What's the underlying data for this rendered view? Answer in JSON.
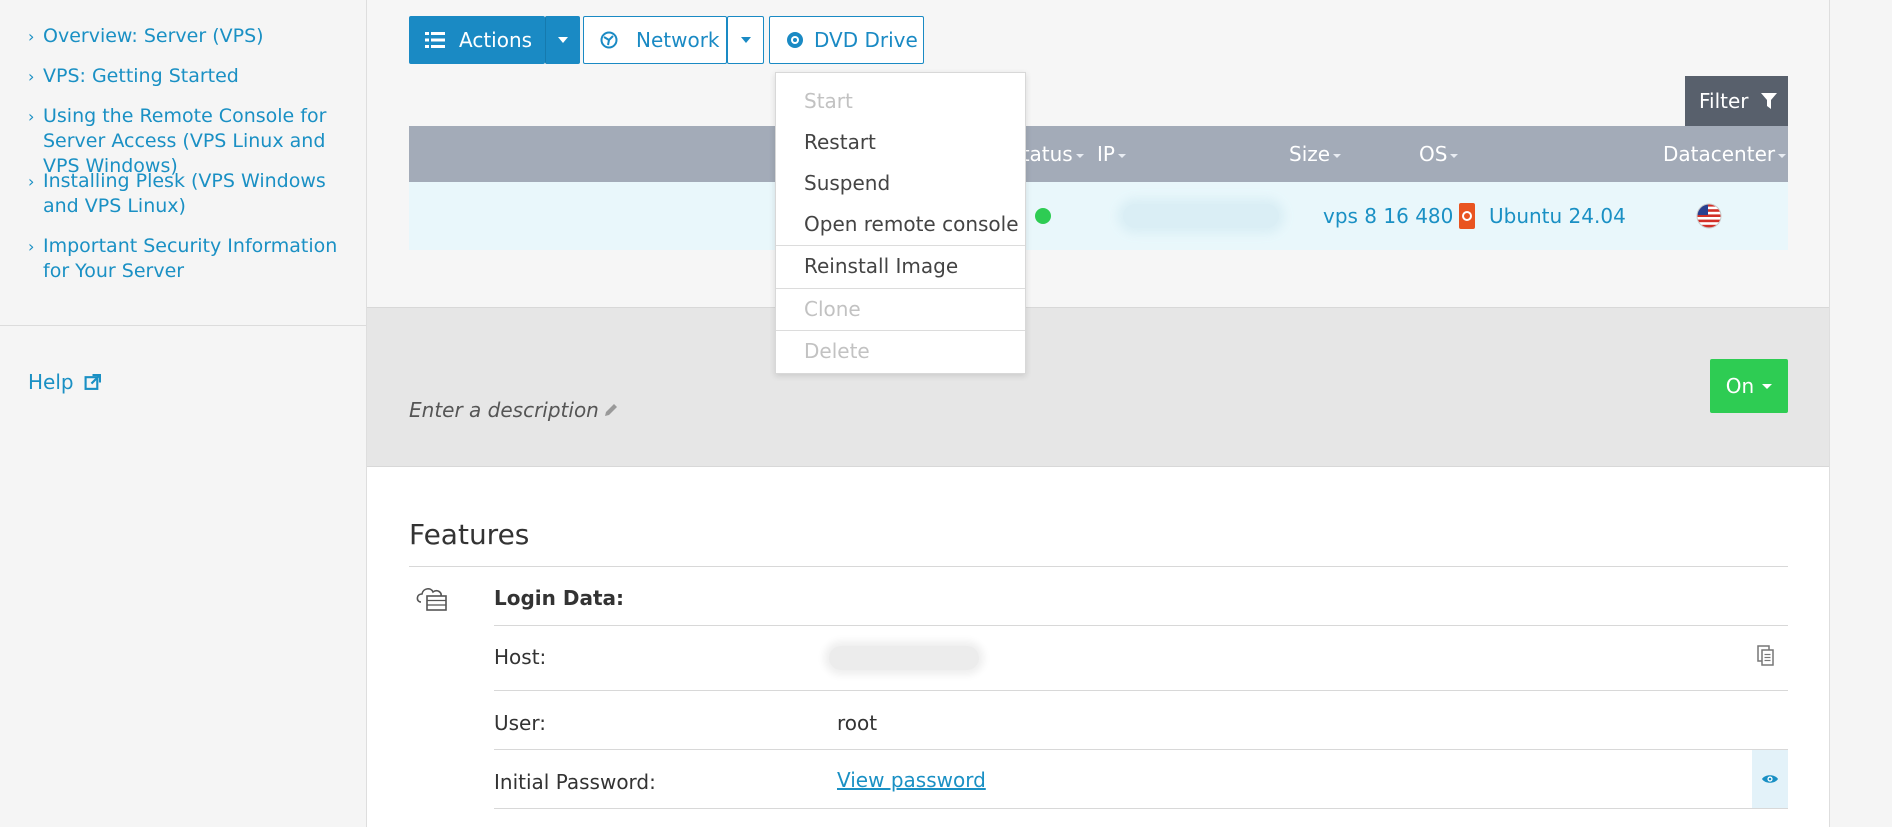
{
  "sidebar": {
    "cut_link": "...",
    "links": [
      "Overview: Server (VPS)",
      "VPS: Getting Started",
      "Using the Remote Console for Server Access (VPS Linux and VPS Windows)",
      "Installing Plesk (VPS Windows and VPS Linux)",
      "Important Security Information for Your Server"
    ],
    "help": "Help"
  },
  "toolbar": {
    "actions": "Actions",
    "network": "Network",
    "dvd": "DVD Drive",
    "filter": "Filter"
  },
  "actions_menu": {
    "items": [
      {
        "label": "Start",
        "enabled": false
      },
      {
        "label": "Restart",
        "enabled": true
      },
      {
        "label": "Suspend",
        "enabled": true
      },
      {
        "label": "Open remote console",
        "enabled": true
      },
      {
        "label": "Reinstall Image",
        "enabled": true
      },
      {
        "label": "Clone",
        "enabled": false
      },
      {
        "label": "Delete",
        "enabled": false
      }
    ]
  },
  "table": {
    "columns": [
      "Status",
      "IP",
      "Size",
      "OS",
      "Datacenter"
    ],
    "row": {
      "status_color": "#2ecc53",
      "size": "vps 8 16 480",
      "os": "Ubuntu 24.04",
      "datacenter_icon": "us-flag-icon"
    }
  },
  "description": {
    "placeholder": "Enter a description",
    "power_button": "On"
  },
  "features": {
    "title": "Features",
    "login_title": "Login Data:",
    "host_label": "Host:",
    "user_label": "User:",
    "user_value": "root",
    "password_label": "Initial Password:",
    "password_link": "View password"
  },
  "colors": {
    "accent": "#1a8ac4",
    "success": "#2ecc53",
    "table_header": "#a3abb8",
    "filter_button": "#58606c"
  }
}
